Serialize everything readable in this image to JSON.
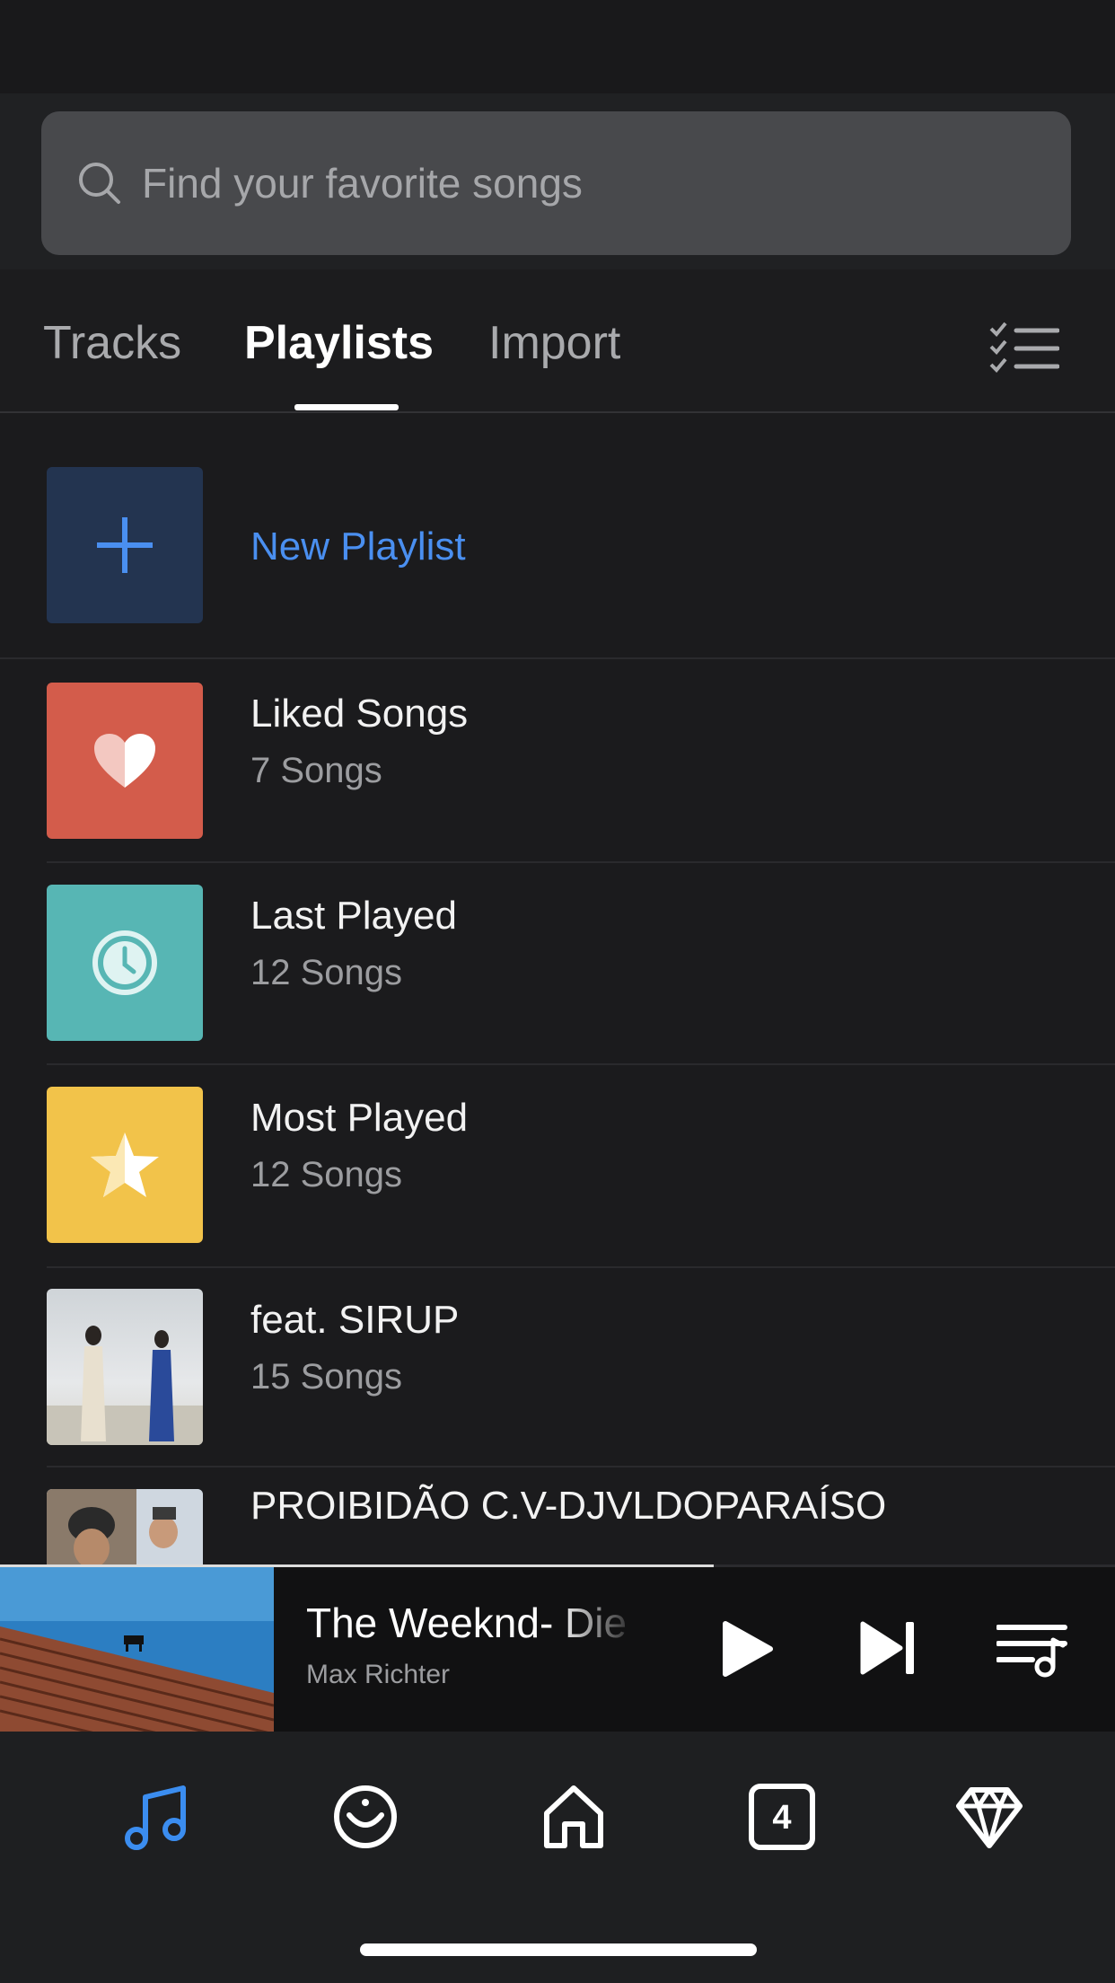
{
  "search": {
    "placeholder": "Find your favorite songs",
    "icon": "search-icon"
  },
  "tabs": [
    {
      "label": "Tracks",
      "active": false
    },
    {
      "label": "Playlists",
      "active": true
    },
    {
      "label": "Import",
      "active": false
    }
  ],
  "sort_icon": "checklist-icon",
  "new_playlist": {
    "label": "New Playlist",
    "icon": "plus-icon",
    "accent": "#4a8ff0",
    "tile_color": "#233450"
  },
  "playlists": [
    {
      "title": "Liked Songs",
      "count": "7 Songs",
      "icon": "heart-icon",
      "color": "#d35c4b"
    },
    {
      "title": "Last Played",
      "count": "12 Songs",
      "icon": "clock-icon",
      "color": "#57b6b4"
    },
    {
      "title": "Most Played",
      "count": "12 Songs",
      "icon": "star-icon",
      "color": "#f2c34a"
    },
    {
      "title": "feat. SIRUP",
      "count": "15 Songs",
      "icon": "album-art"
    },
    {
      "title": "PROIBIDÃO C.V-DJVLDOPARAÍSO",
      "count": "",
      "icon": "album-art"
    }
  ],
  "player": {
    "title": "The Weeknd- Die For You",
    "artist": "Max Richter",
    "progress": 0.64,
    "controls": [
      "play-icon",
      "skip-next-icon",
      "queue-icon"
    ]
  },
  "nav": [
    {
      "name": "music-note-icon",
      "active": true
    },
    {
      "name": "discover-icon",
      "active": false
    },
    {
      "name": "home-icon",
      "active": false
    },
    {
      "name": "badge-icon",
      "active": false,
      "label": "4"
    },
    {
      "name": "diamond-icon",
      "active": false
    }
  ]
}
